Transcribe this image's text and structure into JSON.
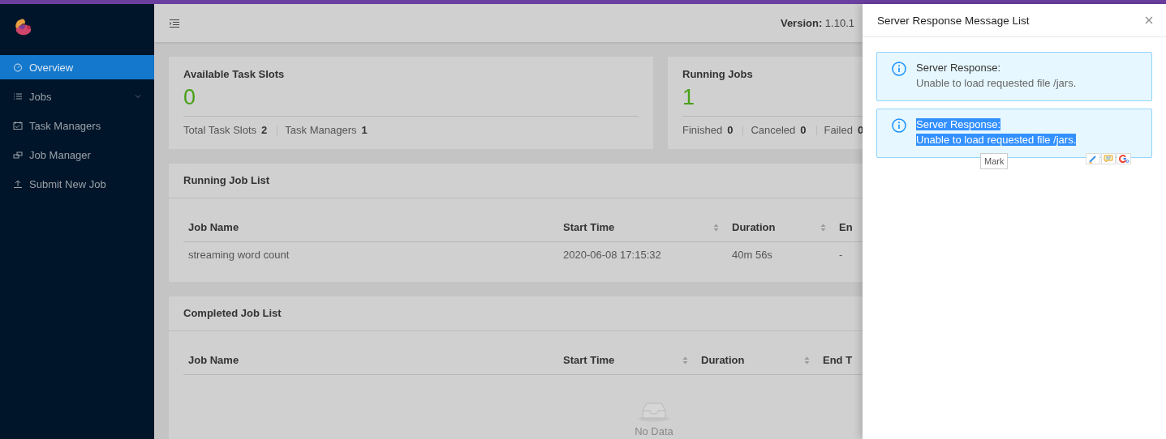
{
  "sidebar": {
    "items": [
      {
        "label": "Overview",
        "selected": true,
        "submenu": false
      },
      {
        "label": "Jobs",
        "selected": false,
        "submenu": true
      },
      {
        "label": "Task Managers",
        "selected": false,
        "submenu": false
      },
      {
        "label": "Job Manager",
        "selected": false,
        "submenu": false
      },
      {
        "label": "Submit New Job",
        "selected": false,
        "submenu": false
      }
    ]
  },
  "header": {
    "version_label": "Version:",
    "version": "1.10.1"
  },
  "stat_cards": [
    {
      "title": "Available Task Slots",
      "value": "0",
      "footer": [
        {
          "label": "Total Task Slots",
          "value": "2"
        },
        {
          "label": "Task Managers",
          "value": "1"
        }
      ]
    },
    {
      "title": "Running Jobs",
      "value": "1",
      "footer": [
        {
          "label": "Finished",
          "value": "0"
        },
        {
          "label": "Canceled",
          "value": "0"
        },
        {
          "label": "Failed",
          "value": "0"
        }
      ]
    }
  ],
  "running_job_list": {
    "title": "Running Job List",
    "columns": [
      {
        "label": "Job Name",
        "sortable": false
      },
      {
        "label": "Start Time",
        "sortable": true
      },
      {
        "label": "Duration",
        "sortable": true
      },
      {
        "label": "En",
        "sortable": false
      }
    ],
    "rows": [
      [
        "streaming word count",
        "2020-06-08 17:15:32",
        "40m 56s",
        "-"
      ]
    ]
  },
  "completed_job_list": {
    "title": "Completed Job List",
    "columns": [
      {
        "label": "Job Name",
        "sortable": false
      },
      {
        "label": "Start Time",
        "sortable": true
      },
      {
        "label": "Duration",
        "sortable": true
      },
      {
        "label": "End T",
        "sortable": false
      }
    ],
    "empty_text": "No Data"
  },
  "drawer": {
    "title": "Server Response Message List",
    "messages": [
      {
        "title": "Server Response:",
        "text": "Unable to load requested file /jars.",
        "text_selected": false
      },
      {
        "title": "Server Response:",
        "text": "Unable to load requested file /jars.",
        "text_selected": true
      }
    ],
    "tooltip": "Mark"
  }
}
